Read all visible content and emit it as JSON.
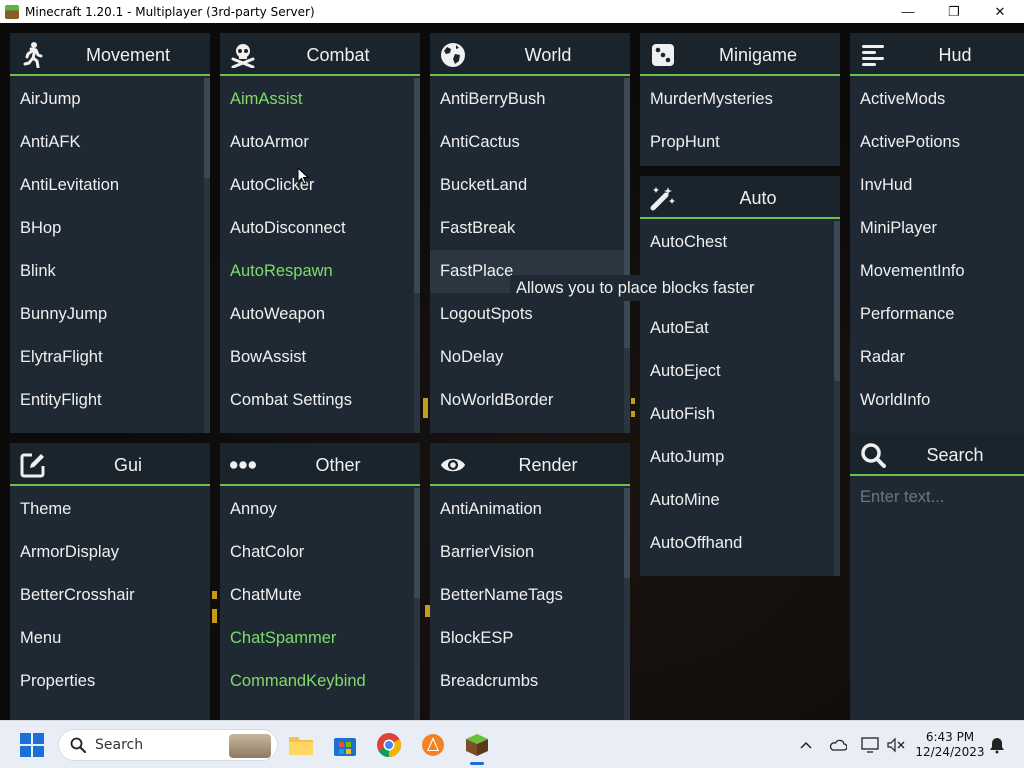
{
  "window": {
    "title": "Minecraft 1.20.1 - Multiplayer (3rd-party Server)",
    "minimize_glyph": "—",
    "maximize_glyph": "❐",
    "close_glyph": "✕"
  },
  "colors": {
    "panel_bg": "#1e2933",
    "header_bg": "#1a242d",
    "accent_green": "#6dc04a",
    "enabled_text": "#7fdc6a",
    "text": "#f0f0f0"
  },
  "panels": {
    "movement": {
      "title": "Movement",
      "icon": "walking-person-icon",
      "items": [
        "AirJump",
        "AntiAFK",
        "AntiLevitation",
        "BHop",
        "Blink",
        "BunnyJump",
        "ElytraFlight",
        "EntityFlight"
      ]
    },
    "combat": {
      "title": "Combat",
      "icon": "skull-crossbones-icon",
      "items": [
        "AimAssist",
        "AutoArmor",
        "AutoClicker",
        "AutoDisconnect",
        "AutoRespawn",
        "AutoWeapon",
        "BowAssist",
        "Combat Settings"
      ],
      "enabled": [
        "AimAssist",
        "AutoRespawn"
      ]
    },
    "world": {
      "title": "World",
      "icon": "globe-icon",
      "items": [
        "AntiBerryBush",
        "AntiCactus",
        "BucketLand",
        "FastBreak",
        "FastPlace",
        "LogoutSpots",
        "NoDelay",
        "NoWorldBorder"
      ],
      "hovered": "FastPlace"
    },
    "minigame": {
      "title": "Minigame",
      "icon": "dice-icon",
      "items": [
        "MurderMysteries",
        "PropHunt"
      ]
    },
    "auto": {
      "title": "Auto",
      "icon": "magic-wand-icon",
      "items": [
        "AutoChest",
        "",
        "AutoEat",
        "AutoEject",
        "AutoFish",
        "AutoJump",
        "AutoMine",
        "AutoOffhand"
      ]
    },
    "hud": {
      "title": "Hud",
      "icon": "align-left-icon",
      "items": [
        "ActiveMods",
        "ActivePotions",
        "InvHud",
        "MiniPlayer",
        "MovementInfo",
        "Performance",
        "Radar",
        "WorldInfo"
      ]
    },
    "search": {
      "title": "Search",
      "icon": "search-icon",
      "placeholder": "Enter text..."
    },
    "gui": {
      "title": "Gui",
      "icon": "edit-icon",
      "items": [
        "Theme",
        "ArmorDisplay",
        "BetterCrosshair",
        "Menu",
        "Properties"
      ]
    },
    "other": {
      "title": "Other",
      "icon": "ellipsis-icon",
      "items": [
        "Annoy",
        "ChatColor",
        "ChatMute",
        "ChatSpammer",
        "CommandKeybind"
      ],
      "enabled": [
        "ChatSpammer",
        "CommandKeybind"
      ]
    },
    "render": {
      "title": "Render",
      "icon": "eye-icon",
      "items": [
        "AntiAnimation",
        "BarrierVision",
        "BetterNameTags",
        "BlockESP",
        "Breadcrumbs"
      ]
    }
  },
  "tooltip": {
    "text": "Allows you to place blocks faster"
  },
  "taskbar": {
    "search_label": "Search",
    "apps": [
      "file-explorer-icon",
      "microsoft-store-icon",
      "chrome-icon",
      "vlc-icon",
      "minecraft-icon"
    ],
    "tray": [
      "chevron-up-icon",
      "onedrive-cloud-icon",
      "display-icon",
      "volume-muted-icon",
      "notification-icon"
    ],
    "time": "6:43 PM",
    "date": "12/24/2023"
  }
}
